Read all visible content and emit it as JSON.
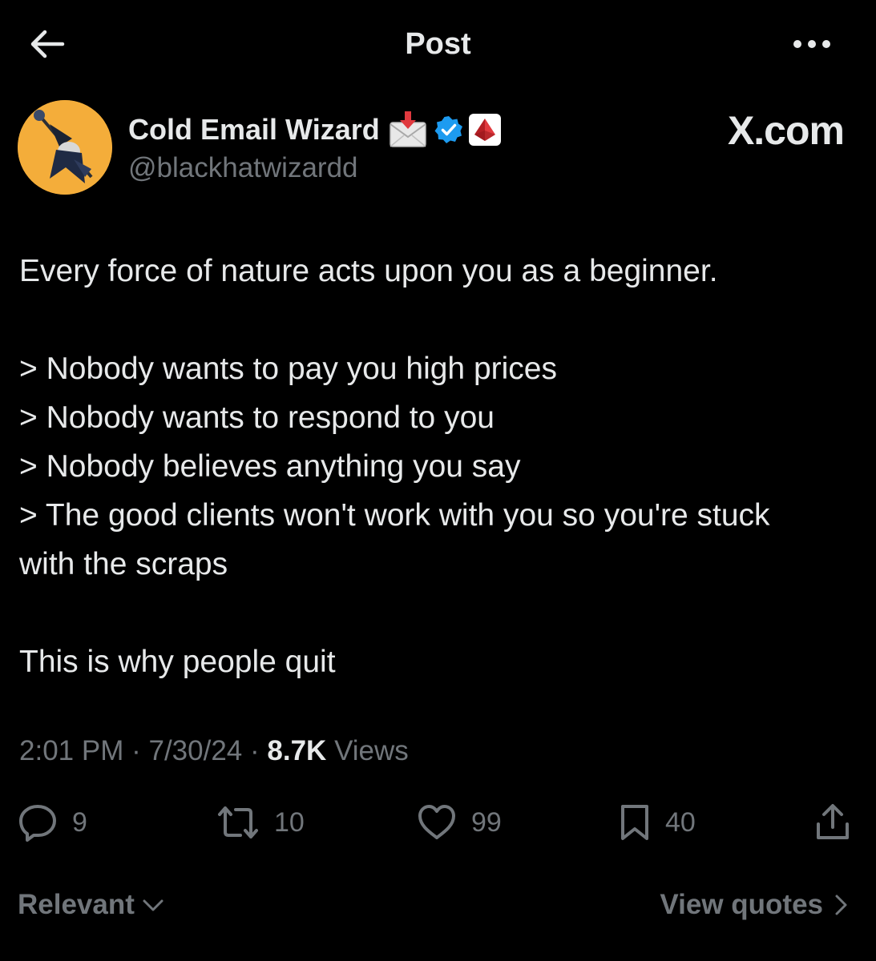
{
  "header": {
    "title": "Post",
    "back_icon": "arrow-left-icon",
    "more_icon": "more-horizontal-icon"
  },
  "author": {
    "display_name": "Cold Email Wizard",
    "handle": "@blackhatwizardd",
    "badges": [
      "incoming-envelope-emoji",
      "verified-badge-icon",
      "red-pyramid-affiliate-icon"
    ],
    "verified_color": "#1d9bf0",
    "avatar_bg": "#f4ad3a"
  },
  "watermark": "X.com",
  "post": {
    "lines": [
      "Every force of nature acts upon you as a beginner.",
      "",
      "> Nobody wants to pay you high prices",
      "> Nobody wants to respond to you",
      "> Nobody believes anything you say",
      "> The good clients won't work with you so you're stuck with the scraps",
      "",
      "This is why people quit"
    ]
  },
  "meta": {
    "time": "2:01 PM",
    "separator": "·",
    "date": "7/30/24",
    "views_count": "8.7K",
    "views_label": "Views"
  },
  "actions": {
    "replies": "9",
    "reposts": "10",
    "likes": "99",
    "bookmarks": "40"
  },
  "footer": {
    "sort_label": "Relevant",
    "view_quotes_label": "View quotes"
  },
  "colors": {
    "background": "#000000",
    "primary_text": "#e7e9ea",
    "secondary_text": "#71767b"
  }
}
